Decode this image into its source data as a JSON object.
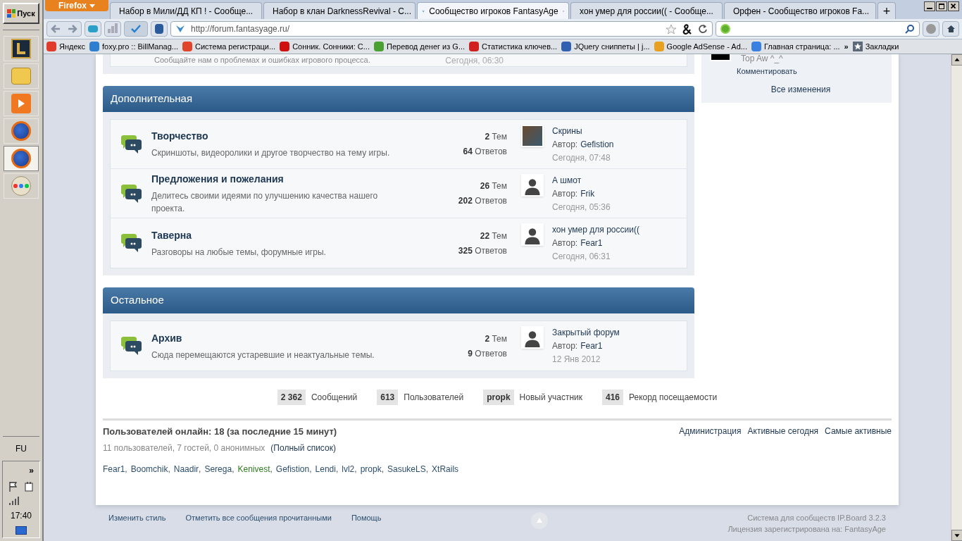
{
  "taskbar": {
    "start": "Пуск",
    "apps": [
      {
        "kind": "game",
        "selected": false
      },
      {
        "kind": "folder",
        "selected": false
      },
      {
        "kind": "player",
        "selected": false
      },
      {
        "kind": "browser",
        "selected": false
      },
      {
        "kind": "browser",
        "selected": true
      },
      {
        "kind": "paint",
        "selected": false
      }
    ],
    "language": "FU",
    "tray_expand": "»",
    "clock": "17:40"
  },
  "browser": {
    "menu_button": "Firefox",
    "tabs": [
      {
        "title": "Набор в Мили/ДД КП ! - Сообще...",
        "selected": false
      },
      {
        "title": "Набор в клан DarknessRevival - С...",
        "selected": false
      },
      {
        "title": "Сообщество игроков FantasyAge",
        "selected": true
      },
      {
        "title": "хон умер для россии(( - Сообще...",
        "selected": false
      },
      {
        "title": "Орфен - Сообщество игроков Fa...",
        "selected": false
      }
    ],
    "new_tab": "+",
    "address": "http://forum.fantasyage.ru/",
    "bookmarks": [
      {
        "label": "Яндекс",
        "color": "#e03a2a"
      },
      {
        "label": "foxy.pro :: BillManag...",
        "color": "#2f7fd0"
      },
      {
        "label": "Система регистраци...",
        "color": "#e0442a"
      },
      {
        "label": "Сонник. Сонники: С...",
        "color": "#d01010"
      },
      {
        "label": "Перевод денег из G...",
        "color": "#4aa030"
      },
      {
        "label": "Статистика ключев...",
        "color": "#d02020"
      },
      {
        "label": "JQuery сниппеты | j...",
        "color": "#3060b0"
      },
      {
        "label": "Google AdSense - Ad...",
        "color": "#e8a020"
      },
      {
        "label": "Главная страница: ...",
        "color": "#3a80e0"
      }
    ],
    "more_bookmarks": "»",
    "bookmarks_menu": "Закладки"
  },
  "partial_row": {
    "description": "Сообщайте нам о проблемах и ошибках игрового процесса.",
    "time": "Сегодня, 06:30"
  },
  "sections": [
    {
      "title": "Дополнительная",
      "forums": [
        {
          "name": "Творчество",
          "description": "Скриншоты, видеоролики и другое творчество на тему игры.",
          "topics": "2",
          "topics_label": "Тем",
          "replies": "64",
          "replies_label": "Ответов",
          "last_title": "Скрины",
          "author_label": "Автор:",
          "author": "Gefistion",
          "time": "Сегодня, 07:48",
          "kind": "photo"
        },
        {
          "name": "Предложения и пожелания",
          "description": "Делитесь своими идеями по улучшению качества нашего проекта.",
          "topics": "26",
          "topics_label": "Тем",
          "replies": "202",
          "replies_label": "Ответов",
          "last_title": "А шмот",
          "author_label": "Автор:",
          "author": "Frik",
          "time": "Сегодня, 05:36",
          "kind": "silhouette"
        },
        {
          "name": "Таверна",
          "description": "Разговоры на любые темы, форумные игры.",
          "topics": "22",
          "topics_label": "Тем",
          "replies": "325",
          "replies_label": "Ответов",
          "last_title": "хон умер для россии((",
          "author_label": "Автор:",
          "author": "Fear1",
          "time": "Сегодня, 06:31",
          "kind": "silhouette"
        }
      ]
    },
    {
      "title": "Остальное",
      "forums": [
        {
          "name": "Архив",
          "description": "Сюда перемещаются устаревшие и неактуальные темы.",
          "topics": "2",
          "topics_label": "Тем",
          "replies": "9",
          "replies_label": "Ответов",
          "last_title": "Закрытый форум",
          "author_label": "Автор:",
          "author": "Fear1",
          "time": "12 Янв 2012",
          "kind": "silhouette"
        }
      ]
    }
  ],
  "sidebar": {
    "partial_text": "Top Aw ^_^",
    "comment_link": "Комментировать",
    "all_changes": "Все изменения"
  },
  "stats": [
    {
      "value": "2 362",
      "label": "Сообщений"
    },
    {
      "value": "613",
      "label": "Пользователей"
    },
    {
      "value": "propk",
      "label": "Новый участник"
    },
    {
      "value": "416",
      "label": "Рекорд посещаемости"
    }
  ],
  "online": {
    "title": "Пользователей онлайн: 18 (за последние 15 минут)",
    "summary": "11 пользователей, 7 гостей, 0 анонимных",
    "full_list": "(Полный список)",
    "separator": ",",
    "links": [
      "Администрация",
      "Активные сегодня",
      "Самые активные"
    ],
    "users": [
      {
        "name": "Fear1",
        "color": "#2c4e6e"
      },
      {
        "name": "Boomchik",
        "color": "#2c4e6e"
      },
      {
        "name": "Naadir",
        "color": "#2c4e6e"
      },
      {
        "name": "Serega",
        "color": "#2c4e6e"
      },
      {
        "name": "Kenivest",
        "color": "#2e7d20"
      },
      {
        "name": "Gefistion",
        "color": "#2c4e6e"
      },
      {
        "name": "Lendi",
        "color": "#2c4e6e"
      },
      {
        "name": "lvl2",
        "color": "#2c4e6e"
      },
      {
        "name": "propk",
        "color": "#2c4e6e"
      },
      {
        "name": "SasukeLS",
        "color": "#2c4e6e"
      },
      {
        "name": "XtRails",
        "color": "#2c4e6e"
      }
    ]
  },
  "footer": {
    "links": [
      "Изменить стиль",
      "Отметить все сообщения прочитанными",
      "Помощь"
    ],
    "powered": "Система для сообществ IP.Board 3.2.3",
    "license": "Лицензия зарегистрирована на: FantasyAge"
  }
}
